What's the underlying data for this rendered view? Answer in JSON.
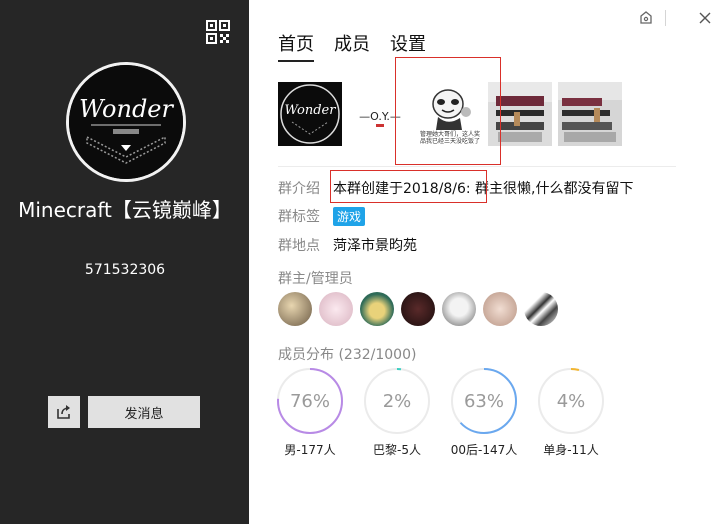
{
  "group": {
    "name": "Minecraft【云镜巅峰】",
    "id": "571532306",
    "avatar_text": "Wonder"
  },
  "actions": {
    "send_message_label": "发消息"
  },
  "tabs": [
    {
      "label": "首页",
      "active": true
    },
    {
      "label": "成员",
      "active": false
    },
    {
      "label": "设置",
      "active": false
    }
  ],
  "photos": {
    "photo1_text": "Wonder",
    "photo2_text": "—O.Y.—",
    "photo3_caption": "管理她大哥们，这人奖品我已经三天没吃饭了"
  },
  "info": {
    "intro_label": "群介绍",
    "intro_value": "本群创建于2018/8/6: 群主很懒,什么都没有留下",
    "tag_label": "群标签",
    "tag_value": "游戏",
    "location_label": "群地点",
    "location_value": "菏泽市景昀苑"
  },
  "admins": {
    "title": "群主/管理员",
    "count": 7
  },
  "distribution": {
    "title": "成员分布 (232/1000)",
    "items": [
      {
        "pct": "76%",
        "value": 0.76,
        "label": "男-177人",
        "color": "#b88ae6"
      },
      {
        "pct": "2%",
        "value": 0.02,
        "label": "巴黎-5人",
        "color": "#3ccfc2"
      },
      {
        "pct": "63%",
        "value": 0.63,
        "label": "00后-147人",
        "color": "#6aa8ef"
      },
      {
        "pct": "4%",
        "value": 0.04,
        "label": "单身-11人",
        "color": "#f2b632"
      }
    ]
  },
  "colors": {
    "left_panel": "#262626",
    "accent_tag": "#1fa3e8",
    "highlight_box": "#d9302a"
  },
  "icons": [
    "qr-code-icon",
    "share-icon",
    "skin-icon",
    "close-icon"
  ]
}
